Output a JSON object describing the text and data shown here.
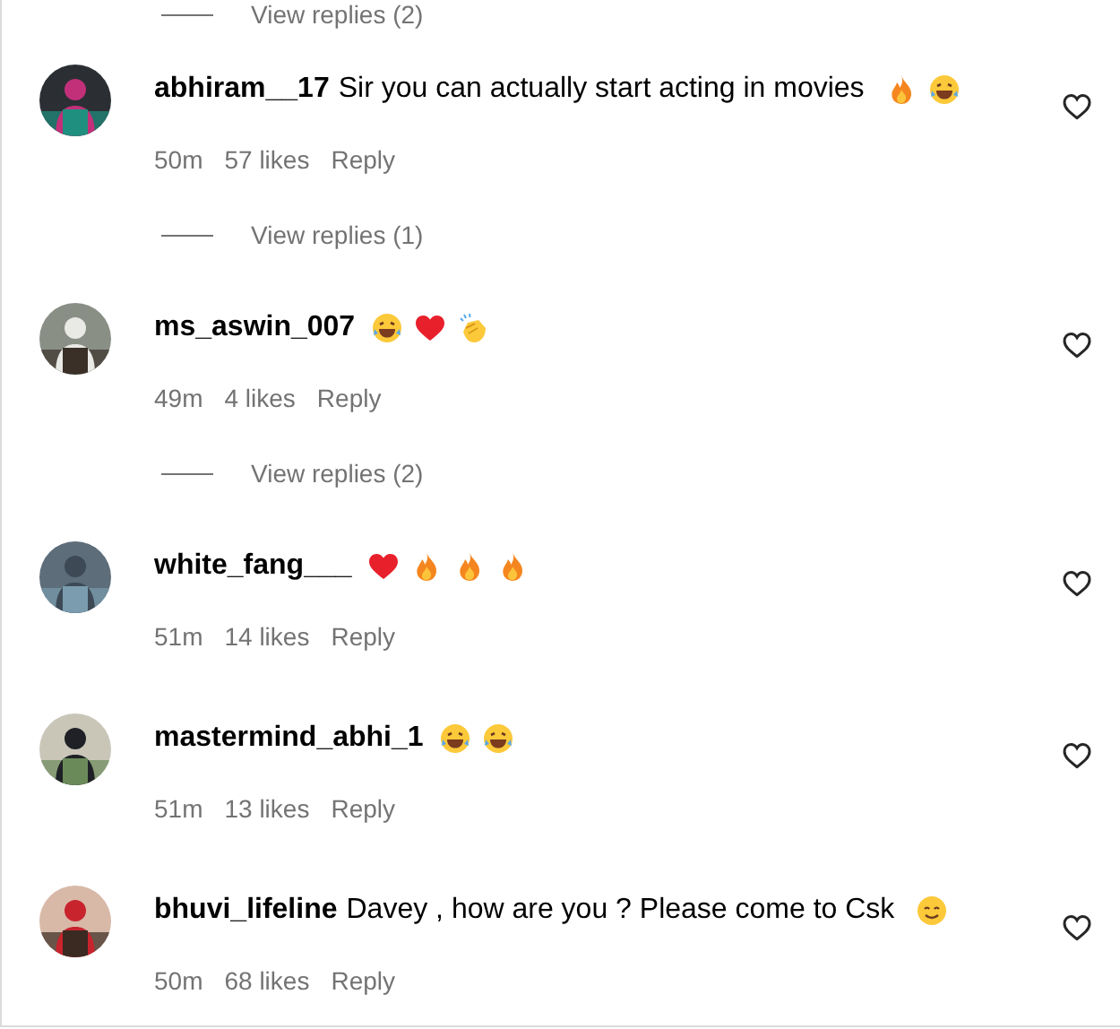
{
  "top_view_replies": {
    "label": "View replies (2)"
  },
  "comments": [
    {
      "username": "abhiram__17",
      "text": "Sir you can actually start acting in movies",
      "emojis": [
        {
          "kind": "fire"
        },
        {
          "kind": "laugh"
        }
      ],
      "time": "50m",
      "likes": "57 likes",
      "reply": "Reply",
      "view_replies": "View replies (1)"
    },
    {
      "username": "ms_aswin_007",
      "emojis": [
        {
          "kind": "laugh"
        },
        {
          "kind": "heart"
        },
        {
          "kind": "clap"
        }
      ],
      "time": "49m",
      "likes": "4 likes",
      "reply": "Reply",
      "view_replies": "View replies (2)"
    },
    {
      "username": "white_fang___",
      "emojis": [
        {
          "kind": "heart"
        },
        {
          "kind": "fire"
        },
        {
          "kind": "fire"
        },
        {
          "kind": "fire"
        }
      ],
      "time": "51m",
      "likes": "14 likes",
      "reply": "Reply"
    },
    {
      "username": "mastermind_abhi_1",
      "emojis": [
        {
          "kind": "laugh"
        },
        {
          "kind": "laugh"
        }
      ],
      "time": "51m",
      "likes": "13 likes",
      "reply": "Reply"
    },
    {
      "username": "bhuvi_lifeline",
      "text": "Davey , how are you ? Please come to Csk",
      "emojis": [
        {
          "kind": "smile"
        }
      ],
      "time": "50m",
      "likes": "68 likes",
      "reply": "Reply"
    }
  ]
}
